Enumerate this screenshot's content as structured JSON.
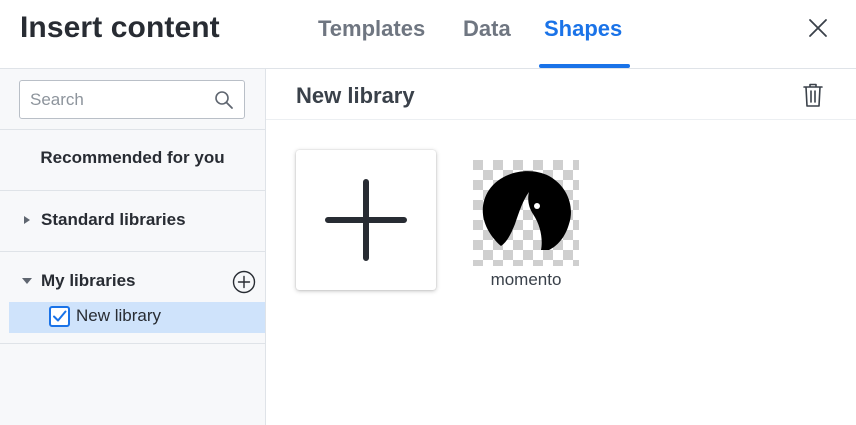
{
  "header": {
    "title": "Insert content",
    "tabs": [
      {
        "label": "Templates",
        "active": false
      },
      {
        "label": "Data",
        "active": false
      },
      {
        "label": "Shapes",
        "active": true
      }
    ],
    "close_icon": "close-icon"
  },
  "sidebar": {
    "search": {
      "placeholder": "Search",
      "value": "",
      "icon": "search-icon"
    },
    "recommended_label": "Recommended for you",
    "standard_libraries": {
      "label": "Standard libraries",
      "expanded": false
    },
    "my_libraries": {
      "label": "My libraries",
      "expanded": true,
      "add_icon": "plus-circle-icon",
      "items": [
        {
          "label": "New library",
          "checked": true
        }
      ]
    }
  },
  "main": {
    "library_title": "New library",
    "delete_icon": "trash-icon",
    "add_shape_icon": "plus-icon",
    "shapes": [
      {
        "label": "momento"
      }
    ]
  },
  "colors": {
    "accent": "#1a73e8",
    "selected_row": "#cfe3fb",
    "sidebar_bg": "#f7f8fa",
    "text_dark": "#282c33"
  }
}
